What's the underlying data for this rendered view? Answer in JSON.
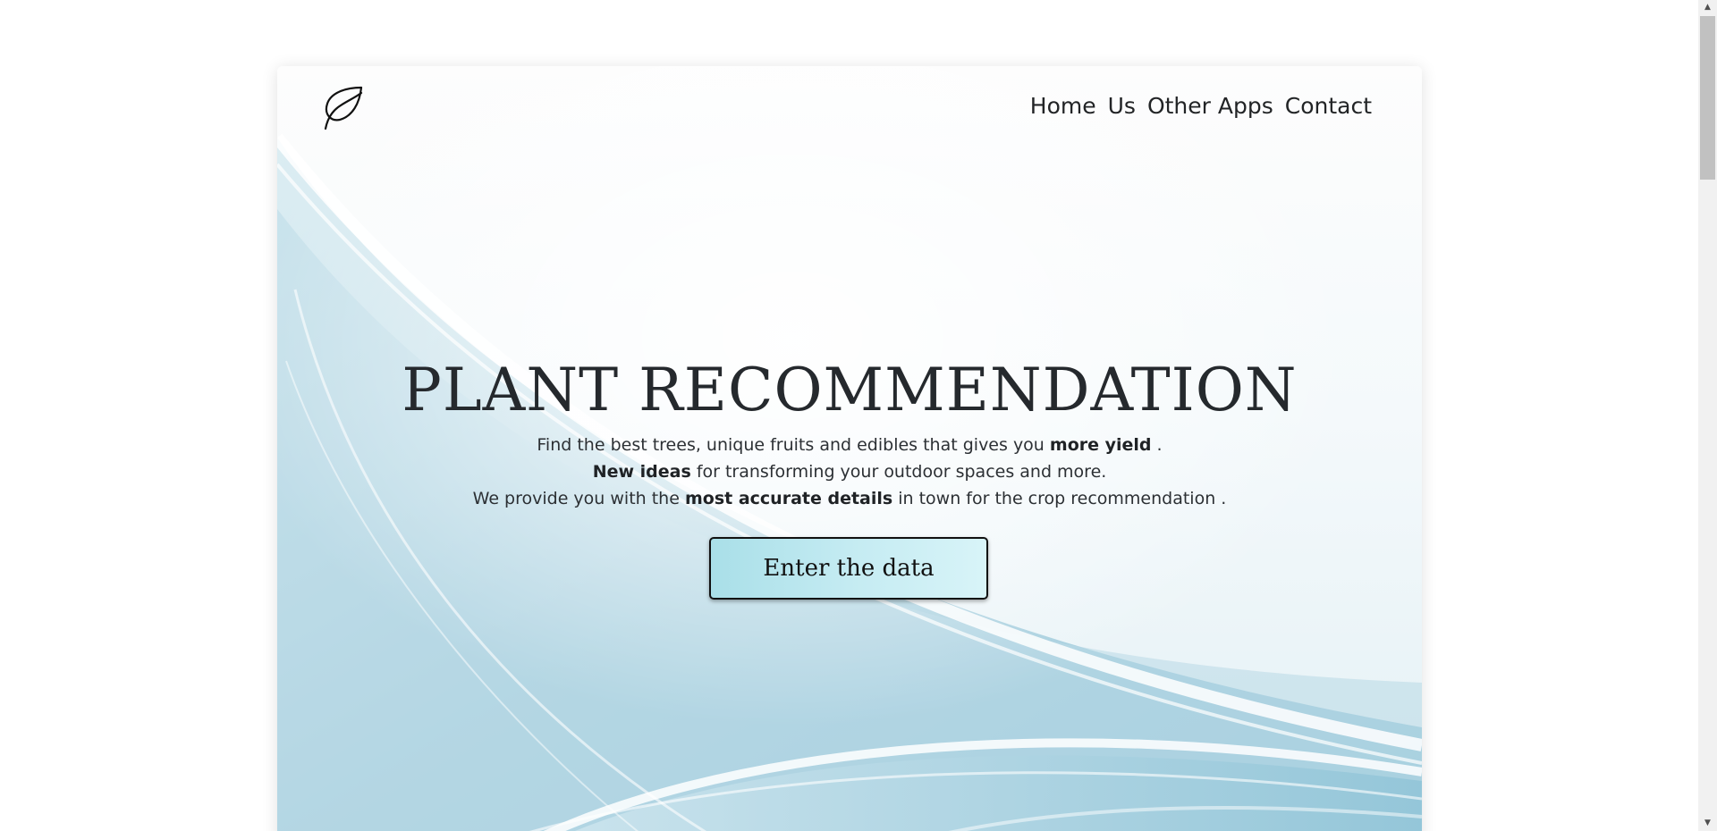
{
  "nav": {
    "items": [
      {
        "label": "Home"
      },
      {
        "label": "Us"
      },
      {
        "label": "Other Apps"
      },
      {
        "label": "Contact"
      }
    ]
  },
  "logo": {
    "icon": "leaf-icon"
  },
  "hero": {
    "title": "PLANT RECOMMENDATION",
    "line1_pre": "Find the best trees, unique fruits and edibles that gives you ",
    "line1_bold": "more yield",
    "line1_post": " .",
    "line2_bold": "New ideas",
    "line2_post": " for transforming your outdoor spaces and more.",
    "line3_pre": "We provide you with the ",
    "line3_bold": "most accurate details",
    "line3_post": " in town for the crop recommendation ."
  },
  "cta": {
    "label": "Enter the data"
  },
  "scrollbar": {
    "up_icon": "arrow-up-icon",
    "down_icon": "arrow-down-icon"
  },
  "colors": {
    "text": "#222426",
    "button_gradient_start": "#a9dfe8",
    "button_gradient_end": "#d8f4f8",
    "background_accent": "#8fc3d6"
  }
}
